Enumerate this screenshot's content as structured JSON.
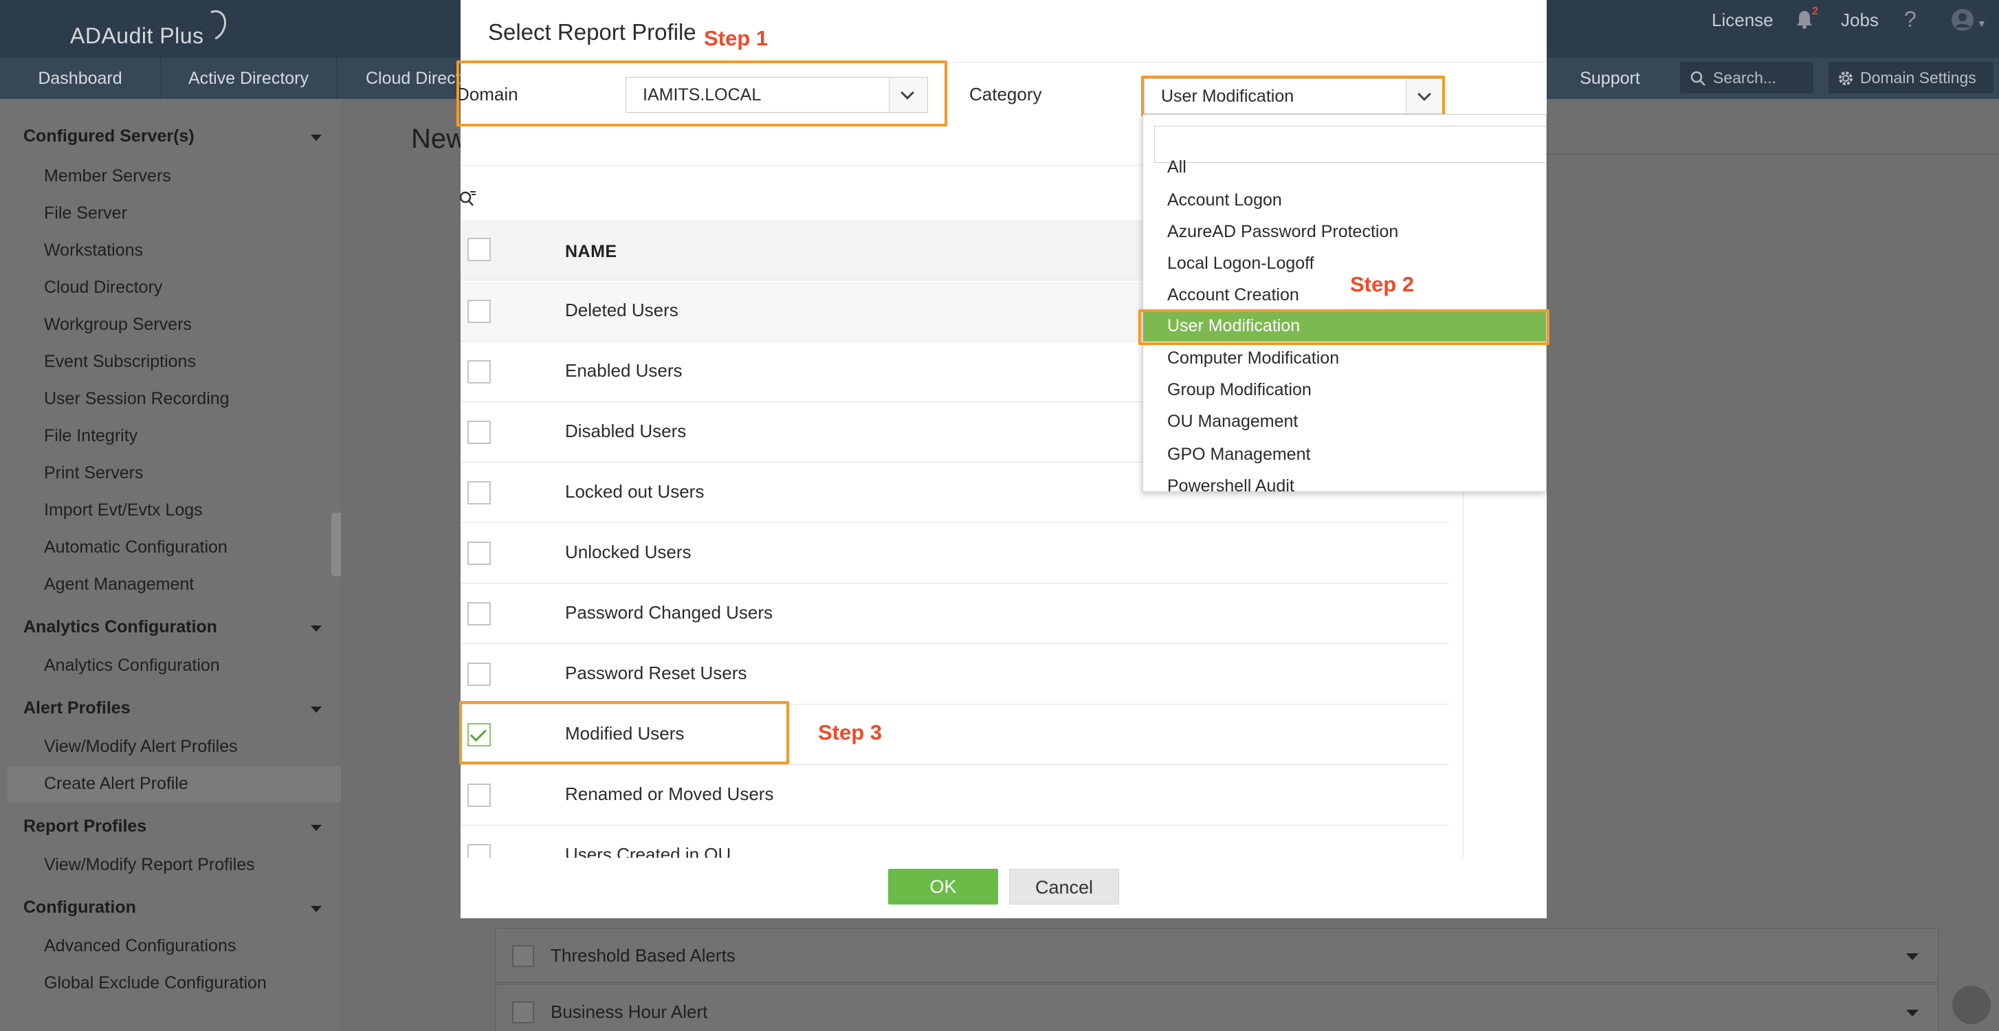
{
  "app": {
    "logo": "ADAudit Plus",
    "top_links": {
      "license": "License",
      "notification_count": "2",
      "jobs": "Jobs"
    }
  },
  "nav": {
    "tabs": [
      "Dashboard",
      "Active Directory",
      "Cloud Direct"
    ],
    "support": "Support",
    "search_placeholder": "Search...",
    "domain_settings": "Domain Settings"
  },
  "sidebar": {
    "groups": [
      {
        "title": "Configured Server(s)",
        "items": [
          "Member Servers",
          "File Server",
          "Workstations",
          "Cloud Directory",
          "Workgroup Servers",
          "Event Subscriptions",
          "User Session Recording",
          "File Integrity",
          "Print Servers",
          "Import Evt/Evtx Logs",
          "Automatic Configuration",
          "Agent Management"
        ]
      },
      {
        "title": "Analytics Configuration",
        "items": [
          "Analytics Configuration"
        ]
      },
      {
        "title": "Alert Profiles",
        "items": [
          "View/Modify Alert Profiles",
          "Create Alert Profile"
        ]
      },
      {
        "title": "Report Profiles",
        "items": [
          "View/Modify Report Profiles"
        ]
      },
      {
        "title": "Configuration",
        "items": [
          "Advanced Configurations",
          "Global Exclude Configuration"
        ]
      }
    ],
    "active_item": "Create Alert Profile"
  },
  "background": {
    "page_title": "New",
    "alert_rows": [
      "Threshold Based Alerts",
      "Business Hour Alert"
    ]
  },
  "modal": {
    "title": "Select Report Profile",
    "domain_label": "Domain",
    "domain_value": "IAMITS.LOCAL",
    "category_label": "Category",
    "category_value": "User Modification",
    "column_header": "NAME",
    "rows": [
      {
        "name": "Deleted Users",
        "checked": false
      },
      {
        "name": "Enabled Users",
        "checked": false
      },
      {
        "name": "Disabled Users",
        "checked": false
      },
      {
        "name": "Locked out Users",
        "checked": false
      },
      {
        "name": "Unlocked Users",
        "checked": false
      },
      {
        "name": "Password Changed Users",
        "checked": false
      },
      {
        "name": "Password Reset Users",
        "checked": false
      },
      {
        "name": "Modified Users",
        "checked": true
      },
      {
        "name": "Renamed or Moved Users",
        "checked": false
      },
      {
        "name": "Users Created in OU",
        "checked": false
      }
    ],
    "ok": "OK",
    "cancel": "Cancel"
  },
  "dropdown": {
    "options": [
      "All",
      "Account Logon",
      "AzureAD Password Protection",
      "Local Logon-Logoff",
      "Account Creation",
      "User Modification",
      "Computer Modification",
      "Group Modification",
      "OU Management",
      "GPO Management",
      "Powershell Audit"
    ],
    "selected": "User Modification"
  },
  "annotations": {
    "step1": "Step 1",
    "step2": "Step 2",
    "step3": "Step 3"
  },
  "colors": {
    "highlight": "#f39a28",
    "step_text": "#ef4a26",
    "ok_green": "#6abb47",
    "selected_option": "#7cb950"
  }
}
